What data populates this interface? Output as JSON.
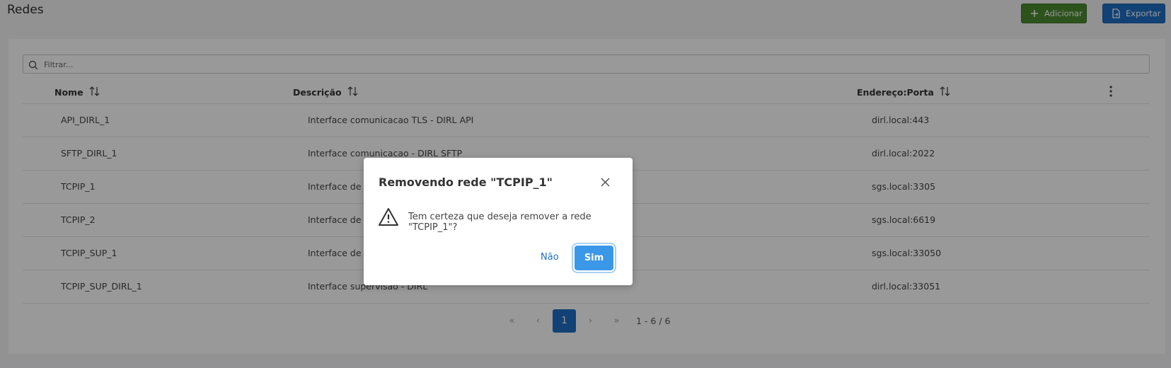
{
  "page": {
    "title": "Redes",
    "add_label": "Adicionar",
    "export_label": "Exportar"
  },
  "filter": {
    "placeholder": "Filtrar..."
  },
  "table": {
    "columns": [
      "Nome",
      "Descrição",
      "Endereço:Porta"
    ],
    "rows": [
      {
        "name": "API_DIRL_1",
        "description": "Interface comunicacao TLS - DIRL API",
        "address": "dirl.local:443"
      },
      {
        "name": "SFTP_DIRL_1",
        "description": "Interface comunicacao - DIRL SFTP",
        "address": "dirl.local:2022"
      },
      {
        "name": "TCPIP_1",
        "description": "Interface de c",
        "address": "sgs.local:3305"
      },
      {
        "name": "TCPIP_2",
        "description": "Interface de c",
        "address": "sgs.local:6619"
      },
      {
        "name": "TCPIP_SUP_1",
        "description": "Interface de s",
        "address": "sgs.local:33050"
      },
      {
        "name": "TCPIP_SUP_DIRL_1",
        "description": "Interface supervisão - DIRL",
        "address": "dirl.local:33051"
      }
    ]
  },
  "pagination": {
    "first": "«",
    "prev": "‹",
    "current": "1",
    "next": "›",
    "last": "»",
    "info": "1 - 6 / 6"
  },
  "dialog": {
    "title": "Removendo rede \"TCPIP_1\"",
    "message": "Tem certeza que deseja remover a rede \"TCPIP_1\"?",
    "no_label": "Não",
    "yes_label": "Sim"
  },
  "colors": {
    "add_button": "#4c8a2f",
    "export_button": "#1f6fc4",
    "primary": "#3b97e8",
    "overlay": "rgba(0,0,0,0.4)"
  },
  "icons": {
    "add": "plus-icon",
    "export": "file-export-icon",
    "filter": "search-icon",
    "sort": "sort-icon",
    "menu": "kebab-menu-icon",
    "close": "close-icon",
    "warning": "warning-icon"
  }
}
